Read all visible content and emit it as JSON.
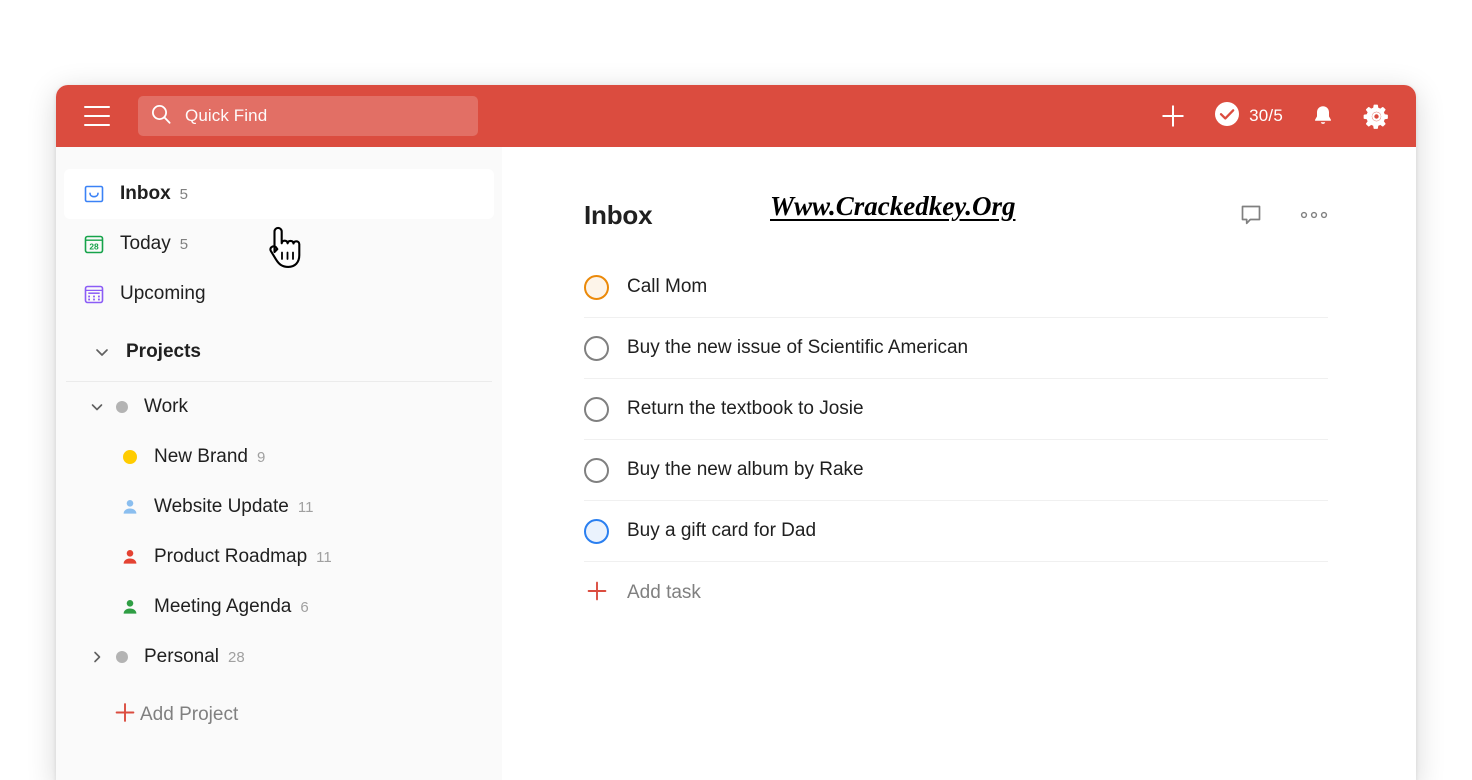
{
  "theme": {
    "brand_red": "#db4c3f",
    "sidebar_bg": "#fafafa",
    "content_bg": "#ffffff",
    "accent_orange": "#eb8909",
    "accent_blue": "#2a7ff0"
  },
  "topbar": {
    "menu_icon": "hamburger-icon",
    "search": {
      "icon": "search-icon",
      "placeholder": "Quick Find",
      "value": ""
    },
    "add_icon": "plus-icon",
    "karma": {
      "icon": "check-circle-icon",
      "count": "30/5"
    },
    "notifications_icon": "bell-icon",
    "settings_icon": "gear-icon"
  },
  "sidebar": {
    "nav": [
      {
        "label": "Inbox",
        "count": "5",
        "icon": "inbox-tray-icon",
        "active": true
      },
      {
        "label": "Today",
        "count": "5",
        "icon": "calendar-28-icon",
        "active": false
      },
      {
        "label": "Upcoming",
        "count": "",
        "icon": "calendar-grid-icon",
        "active": false
      }
    ],
    "projects_section": {
      "label": "Projects",
      "caret": "chevron-down-icon"
    },
    "projects": [
      {
        "label": "Work",
        "count": "",
        "caret": "chevron-down-icon",
        "icon": "gray-dot-icon",
        "dot_color": "#b3b3b3",
        "expanded": true,
        "children": [
          {
            "label": "New Brand",
            "count": "9",
            "icon": "yellow-dot-icon",
            "dot_color": "#ffcc00"
          },
          {
            "label": "Website Update",
            "count": "11",
            "icon": "person-icon",
            "dot_color": "#8abeef"
          },
          {
            "label": "Product Roadmap",
            "count": "11",
            "icon": "person-icon",
            "dot_color": "#e44232"
          },
          {
            "label": "Meeting Agenda",
            "count": "6",
            "icon": "person-icon",
            "dot_color": "#2f9e44"
          }
        ]
      },
      {
        "label": "Personal",
        "count": "28",
        "caret": "chevron-right-icon",
        "icon": "gray-dot-icon",
        "dot_color": "#b3b3b3",
        "expanded": false,
        "children": []
      }
    ],
    "add_project": {
      "label": "Add Project",
      "icon": "plus-icon"
    }
  },
  "main": {
    "title": "Inbox",
    "watermark": "Www.Crackedkey.Org",
    "comments_icon": "comment-bubble-icon",
    "more_icon": "more-horizontal-icon",
    "tasks": [
      {
        "text": "Call Mom",
        "checkbox": "orange"
      },
      {
        "text": "Buy the new issue of Scientific American",
        "checkbox": "gray"
      },
      {
        "text": "Return the textbook to Josie",
        "checkbox": "gray"
      },
      {
        "text": "Buy the new album by Rake",
        "checkbox": "gray"
      },
      {
        "text": "Buy a gift card for Dad",
        "checkbox": "blue"
      }
    ],
    "add_task": {
      "label": "Add task",
      "icon": "plus-icon"
    }
  },
  "cursor": {
    "icon": "pointing-hand-cursor"
  }
}
